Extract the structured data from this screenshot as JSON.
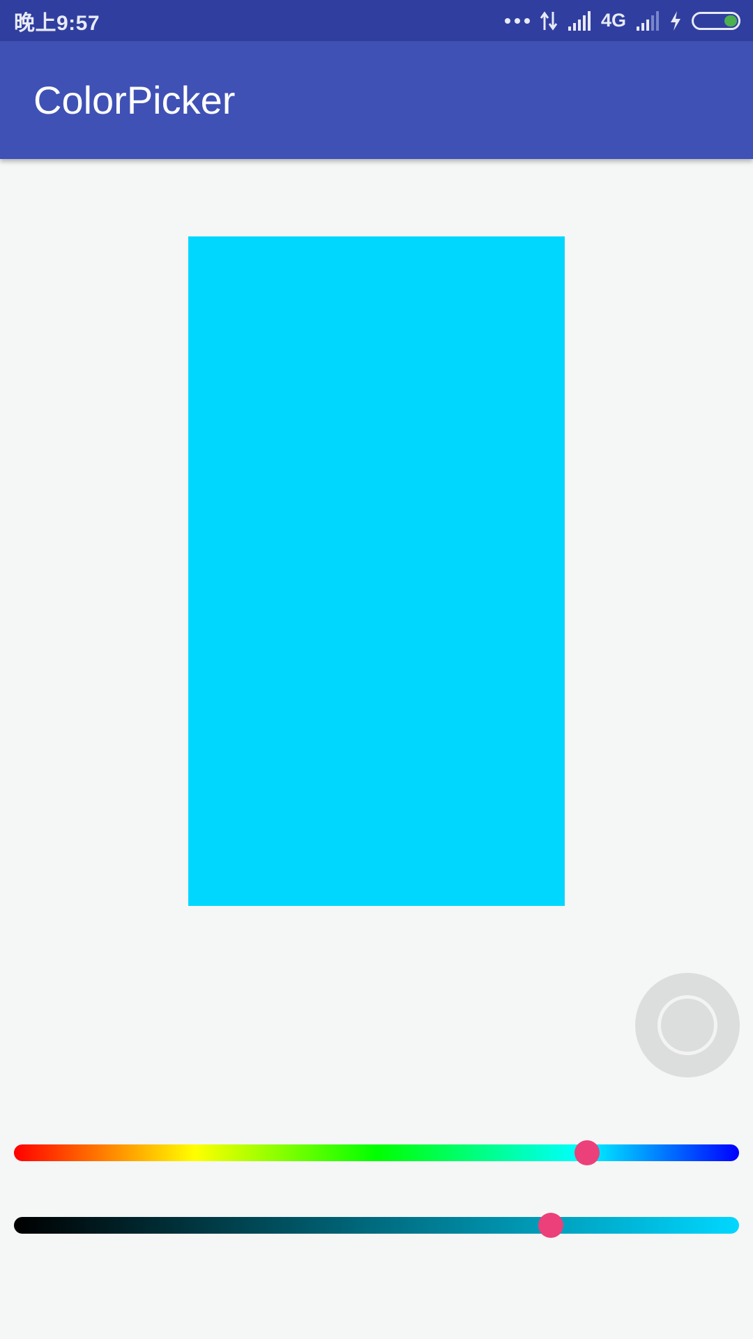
{
  "status_bar": {
    "time": "晚上9:57",
    "network": "4G",
    "icons": [
      "more-dots-icon",
      "data-transfer-icon",
      "signal-icon",
      "signal-weak-icon",
      "charging-icon",
      "battery-icon"
    ],
    "background": "#303f9f"
  },
  "app_bar": {
    "title": "ColorPicker",
    "background": "#3f51b5"
  },
  "preview": {
    "color": "#00d7ff"
  },
  "fab": {
    "icon": "circle-ring-icon"
  },
  "sliders": {
    "hue": {
      "value": 0.79,
      "thumb_color": "#ec407a"
    },
    "brightness": {
      "value": 0.74,
      "end_color": "#00d7ff",
      "thumb_color": "#ec407a"
    }
  }
}
